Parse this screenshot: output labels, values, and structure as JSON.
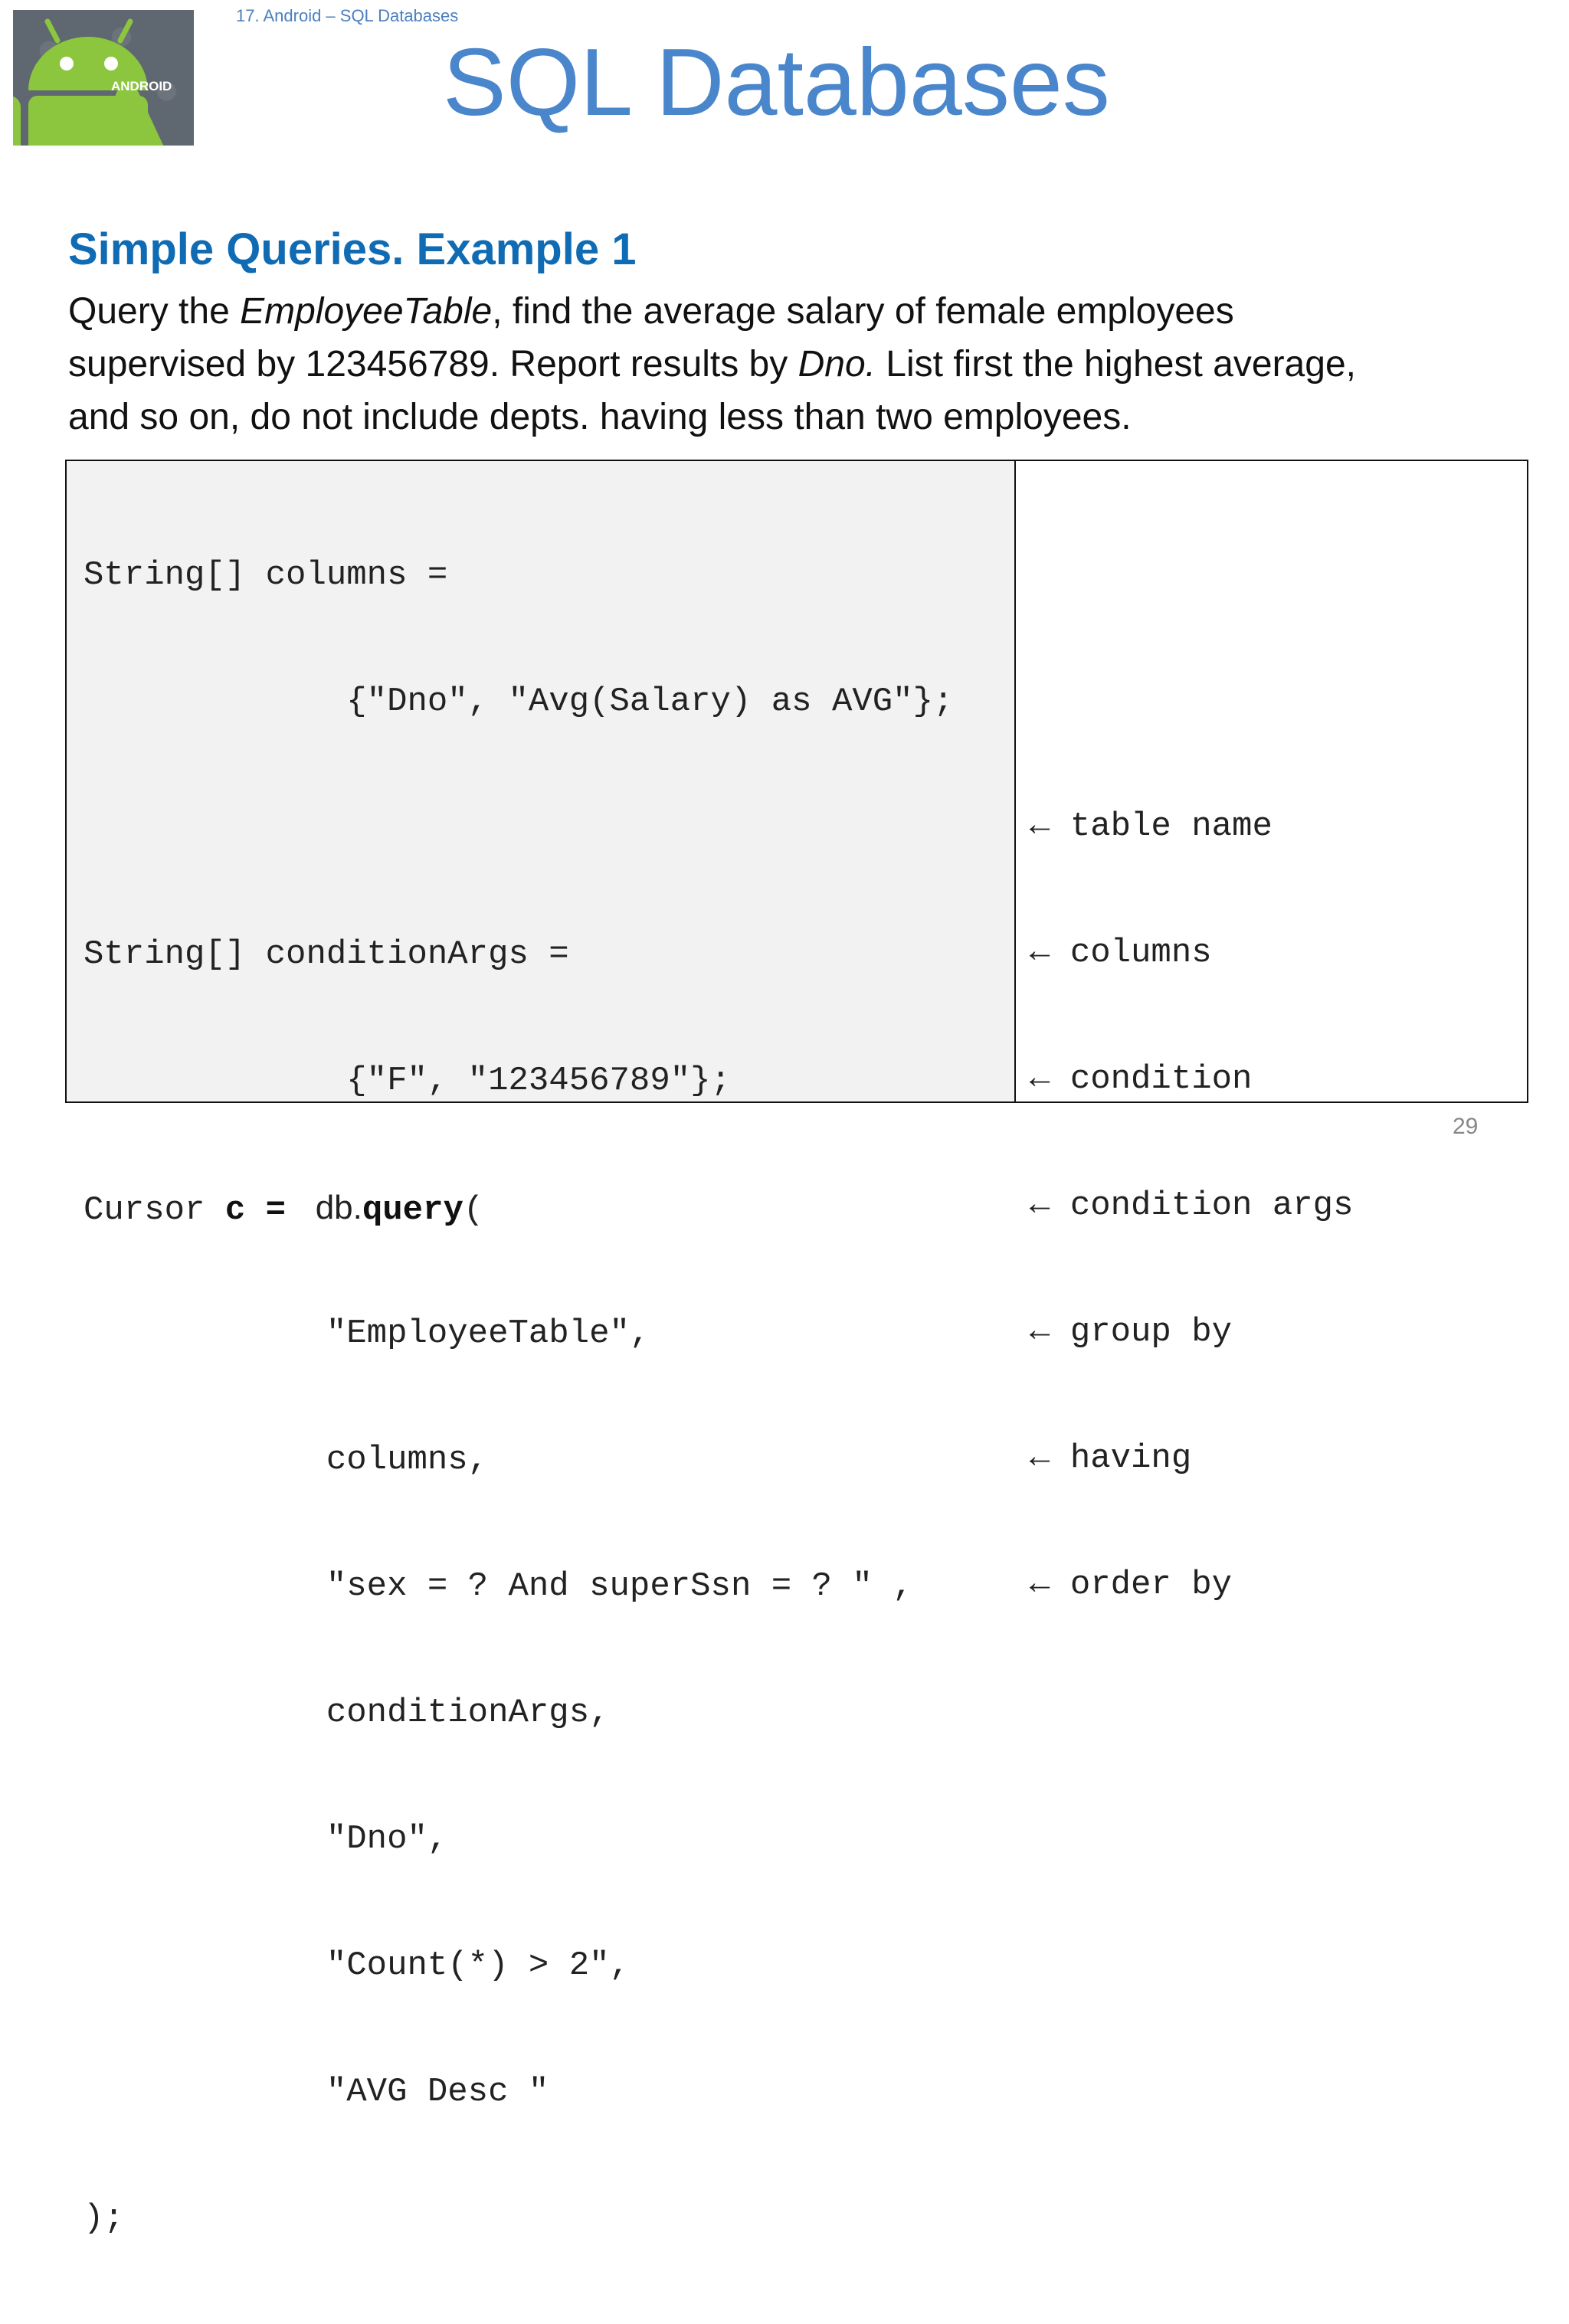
{
  "header": {
    "breadcrumb": "17. Android – SQL Databases",
    "title": "SQL Databases",
    "logo_icon": "android-logo-icon",
    "logo_text": "ANDROID"
  },
  "section": {
    "heading": "Simple Queries. Example 1",
    "description_parts": {
      "p1": "Query the ",
      "p1_em": "EmployeeTable",
      "p2": ", find the average salary of female employees",
      "p3": "supervised by 123456789. Report results by ",
      "p3_em": "Dno.",
      "p4": " List first the highest average,",
      "p5": "and so on, do not include depts. having less than two employees."
    }
  },
  "code": {
    "lines": {
      "l1": "String[] columns =",
      "l2": "             {\"Dno\", \"Avg(Salary) as AVG\"};",
      "l3": "String[] conditionArgs =",
      "l4": "             {\"F\", \"123456789\"};",
      "l5_a": "Cursor ",
      "l5_b": "c = ",
      "l5_c": " db.",
      "l5_d": "query",
      "l5_e": "(",
      "l6": "            \"EmployeeTable\",",
      "l7": "            columns,",
      "l8": "            \"sex = ? And superSsn = ? \" ,",
      "l9": "            conditionArgs,",
      "l10": "            \"Dno\",",
      "l11": "            \"Count(*) > 2\",",
      "l12": "            \"AVG Desc \"",
      "l13": ");"
    }
  },
  "annotations": {
    "arrow": "←",
    "items": [
      "table name",
      "columns",
      "condition",
      "condition args",
      "group by",
      "having",
      "order by"
    ]
  },
  "footer": {
    "page_number": "29"
  }
}
